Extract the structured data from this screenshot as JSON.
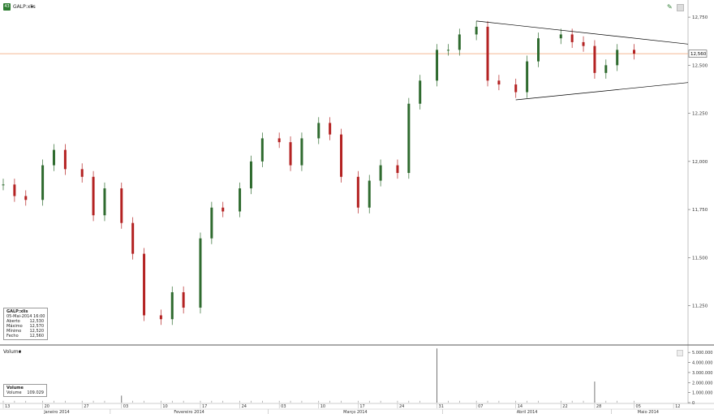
{
  "header": {
    "symbol_label": "GALP:xlis",
    "dropdown_arrow": "▾",
    "badge_text": "43"
  },
  "volume_panel": {
    "label": "Volume",
    "dropdown_arrow": "▾",
    "legend_title": "Volume",
    "legend_label": "Volume",
    "legend_value": "109.029"
  },
  "price_legend": {
    "title": "GALP:xlis",
    "datetime": "05-Mai-2014 16:00",
    "rows": [
      {
        "label": "Aberto",
        "value": "12,530"
      },
      {
        "label": "Máximo",
        "value": "12,570"
      },
      {
        "label": "Mínimo",
        "value": "12,520"
      },
      {
        "label": "Fecho",
        "value": "12,560"
      }
    ]
  },
  "colors": {
    "up": "#2f6b2f",
    "down": "#b42222",
    "price_line": "#f0a070",
    "trendline": "#000000"
  },
  "chart_data": [
    {
      "type": "candlestick",
      "title": "GALP:xlis",
      "ylim": [
        11.05,
        12.78
      ],
      "y_ticks": [
        "12,750",
        "12,500",
        "12,250",
        "12,000",
        "11,750",
        "11,500",
        "11,250"
      ],
      "y_tick_values": [
        12.75,
        12.5,
        12.25,
        12.0,
        11.75,
        11.5,
        11.25
      ],
      "last_price": 12.56,
      "last_price_label": "12,560",
      "x_tick_labels": [
        "13",
        "20",
        "27",
        "03",
        "10",
        "17",
        "24",
        "03",
        "10",
        "17",
        "24",
        "31",
        "07",
        "14",
        "22",
        "28",
        "05",
        "12"
      ],
      "month_labels": [
        "Janeiro 2014",
        "Fevereiro 2014",
        "Março 2014",
        "Abril 2014",
        "Maio 2014"
      ],
      "series": [
        {
          "date": "2014-01-13",
          "close": 11.88
        },
        {
          "date": "2014-01-15",
          "close": 11.82
        },
        {
          "date": "2014-01-17",
          "close": 11.8
        },
        {
          "date": "2014-01-20",
          "close": 11.98
        },
        {
          "date": "2014-01-22",
          "close": 12.06
        },
        {
          "date": "2014-01-24",
          "close": 11.96
        },
        {
          "date": "2014-01-27",
          "close": 11.92
        },
        {
          "date": "2014-01-29",
          "close": 11.72
        },
        {
          "date": "2014-01-31",
          "close": 11.86
        },
        {
          "date": "2014-02-03",
          "close": 11.68
        },
        {
          "date": "2014-02-05",
          "close": 11.52
        },
        {
          "date": "2014-02-07",
          "close": 11.2
        },
        {
          "date": "2014-02-10",
          "close": 11.18
        },
        {
          "date": "2014-02-12",
          "close": 11.32
        },
        {
          "date": "2014-02-14",
          "close": 11.24
        },
        {
          "date": "2014-02-17",
          "close": 11.6
        },
        {
          "date": "2014-02-19",
          "close": 11.76
        },
        {
          "date": "2014-02-21",
          "close": 11.74
        },
        {
          "date": "2014-02-24",
          "close": 11.86
        },
        {
          "date": "2014-02-26",
          "close": 12.0
        },
        {
          "date": "2014-02-28",
          "close": 12.12
        },
        {
          "date": "2014-03-03",
          "close": 12.1
        },
        {
          "date": "2014-03-05",
          "close": 11.98
        },
        {
          "date": "2014-03-07",
          "close": 12.12
        },
        {
          "date": "2014-03-10",
          "close": 12.2
        },
        {
          "date": "2014-03-12",
          "close": 12.14
        },
        {
          "date": "2014-03-14",
          "close": 11.92
        },
        {
          "date": "2014-03-17",
          "close": 11.76
        },
        {
          "date": "2014-03-19",
          "close": 11.9
        },
        {
          "date": "2014-03-21",
          "close": 11.98
        },
        {
          "date": "2014-03-24",
          "close": 11.94
        },
        {
          "date": "2014-03-26",
          "close": 12.3
        },
        {
          "date": "2014-03-28",
          "close": 12.42
        },
        {
          "date": "2014-03-31",
          "close": 12.58
        },
        {
          "date": "2014-04-02",
          "close": 12.58
        },
        {
          "date": "2014-04-04",
          "close": 12.66
        },
        {
          "date": "2014-04-07",
          "close": 12.7
        },
        {
          "date": "2014-04-09",
          "close": 12.42
        },
        {
          "date": "2014-04-11",
          "close": 12.4
        },
        {
          "date": "2014-04-14",
          "close": 12.36
        },
        {
          "date": "2014-04-16",
          "close": 12.52
        },
        {
          "date": "2014-04-18",
          "close": 12.64
        },
        {
          "date": "2014-04-22",
          "close": 12.66
        },
        {
          "date": "2014-04-24",
          "close": 12.62
        },
        {
          "date": "2014-04-26",
          "close": 12.6
        },
        {
          "date": "2014-04-28",
          "close": 12.46
        },
        {
          "date": "2014-04-30",
          "close": 12.5
        },
        {
          "date": "2014-05-02",
          "close": 12.58
        },
        {
          "date": "2014-05-05",
          "close": 12.56
        }
      ]
    },
    {
      "type": "bar",
      "title": "Volume",
      "ylim": [
        0,
        5500000
      ],
      "y_ticks": [
        "5.000.000",
        "4.000.000",
        "3.000.000",
        "2.000.000",
        "1.000.000",
        "0"
      ],
      "y_tick_values": [
        5000000,
        4000000,
        3000000,
        2000000,
        1000000,
        0
      ],
      "spikes": [
        {
          "date": "2014-03-31",
          "value": 5400000
        },
        {
          "date": "2014-04-28",
          "value": 2100000
        },
        {
          "date": "2014-02-03",
          "value": 700000
        }
      ]
    }
  ]
}
